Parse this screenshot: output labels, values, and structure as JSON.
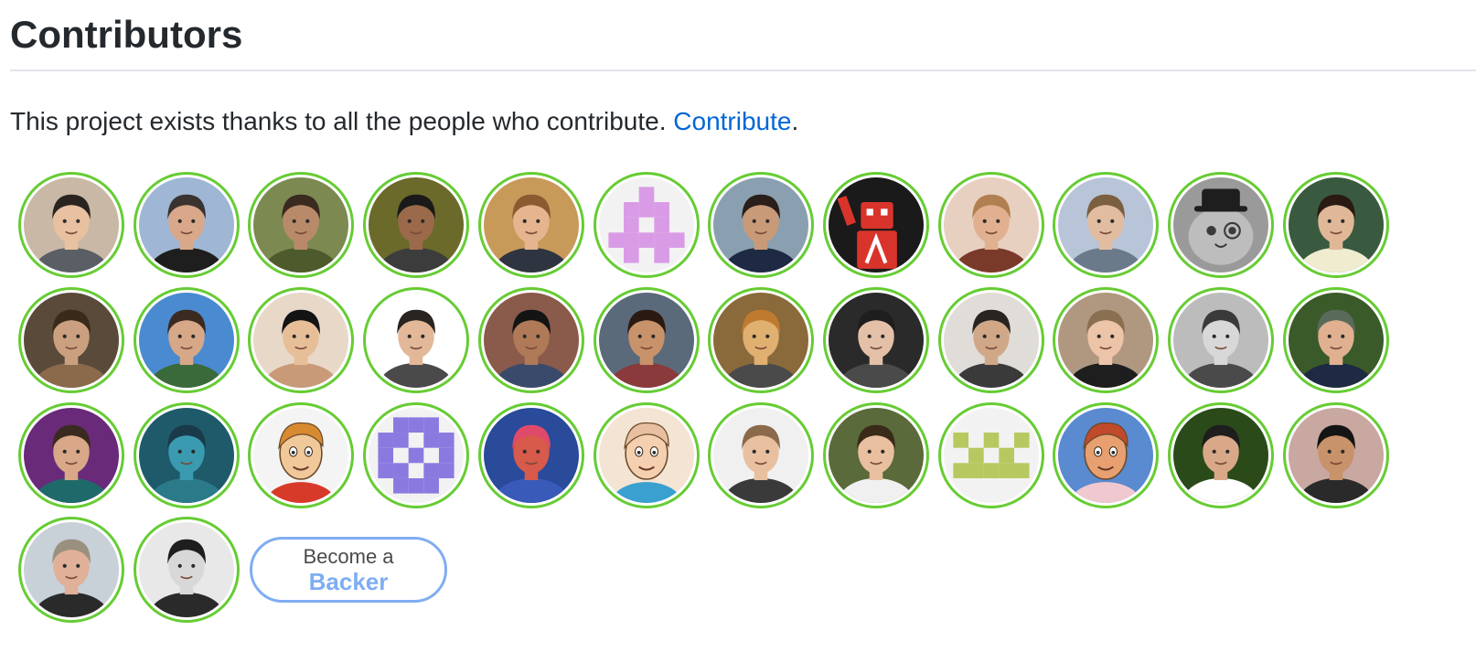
{
  "heading": "Contributors",
  "intro": {
    "text": "This project exists thanks to all the people who contribute.",
    "link_label": "Contribute",
    "suffix": "."
  },
  "colors": {
    "avatar_border": "#66cc33",
    "link": "#0366d6",
    "backer_accent": "#7fadf2"
  },
  "contributors": [
    {
      "kind": "photo",
      "bg": "#c9b8a6",
      "skin": "#e8c1a0",
      "hair": "#2a2420",
      "shirt": "#5a5f66"
    },
    {
      "kind": "photo",
      "bg": "#9fb6d4",
      "skin": "#d9a88a",
      "hair": "#3a3330",
      "shirt": "#1e1e1e"
    },
    {
      "kind": "photo",
      "bg": "#7c8a52",
      "skin": "#b98a6a",
      "hair": "#3b2a20",
      "shirt": "#4d5a2c"
    },
    {
      "kind": "photo",
      "bg": "#6b6a2a",
      "skin": "#9a6a4a",
      "hair": "#1a1a1a",
      "shirt": "#3c3c3c"
    },
    {
      "kind": "photo",
      "bg": "#c89a5a",
      "skin": "#e4b58e",
      "hair": "#8a5a30",
      "shirt": "#2e3440"
    },
    {
      "kind": "pixel",
      "bg": "#f2f2f2",
      "fg": "#d99be6",
      "pattern": "a"
    },
    {
      "kind": "photo",
      "bg": "#8aa0b0",
      "skin": "#c99a78",
      "hair": "#2a1f1a",
      "shirt": "#1e2a44"
    },
    {
      "kind": "robot",
      "bg": "#1a1a1a",
      "fg": "#d9342b"
    },
    {
      "kind": "photo",
      "bg": "#e8d0c0",
      "skin": "#e0b090",
      "hair": "#b08050",
      "shirt": "#7a3a2a"
    },
    {
      "kind": "photo",
      "bg": "#b8c4d8",
      "skin": "#e2bca0",
      "hair": "#7a6040",
      "shirt": "#6a7a8a"
    },
    {
      "kind": "cat",
      "bg": "#9a9a9a",
      "fg": "#5a5a5a"
    },
    {
      "kind": "photo",
      "bg": "#3a5a40",
      "skin": "#e0b898",
      "hair": "#2a1a12",
      "shirt": "#f0ecd0"
    },
    {
      "kind": "photo",
      "bg": "#5a4a3a",
      "skin": "#caa080",
      "hair": "#3a2a1a",
      "shirt": "#8a6a4a"
    },
    {
      "kind": "photo",
      "bg": "#4a8ad0",
      "skin": "#d6a888",
      "hair": "#3a2a20",
      "shirt": "#3a6a3a"
    },
    {
      "kind": "photo",
      "bg": "#e8d8c8",
      "skin": "#e6be98",
      "hair": "#141414",
      "shirt": "#c89a78"
    },
    {
      "kind": "photo",
      "bg": "#ffffff",
      "skin": "#e2b898",
      "hair": "#2a2420",
      "shirt": "#4a4a4a"
    },
    {
      "kind": "photo",
      "bg": "#8a5a4a",
      "skin": "#b07a58",
      "hair": "#141414",
      "shirt": "#3a4a6a"
    },
    {
      "kind": "photo",
      "bg": "#5a6a7a",
      "skin": "#c8926a",
      "hair": "#2a1a12",
      "shirt": "#8a3a3a"
    },
    {
      "kind": "photo",
      "bg": "#8a6a3a",
      "skin": "#e0b070",
      "hair": "#c07a30",
      "shirt": "#4a4a4a"
    },
    {
      "kind": "photo",
      "bg": "#2a2a2a",
      "skin": "#e4c0a8",
      "hair": "#1e1e1e",
      "shirt": "#4a4a4a"
    },
    {
      "kind": "photo",
      "bg": "#e0dcd8",
      "skin": "#d0a888",
      "hair": "#2a2420",
      "shirt": "#3a3a3a"
    },
    {
      "kind": "photo",
      "bg": "#b09880",
      "skin": "#ecc4a8",
      "hair": "#8a7050",
      "shirt": "#1e1e1e"
    },
    {
      "kind": "photo",
      "bg": "#bcbcbc",
      "skin": "#d8d8d8",
      "hair": "#3a3a3a",
      "shirt": "#4a4a4a"
    },
    {
      "kind": "photo",
      "bg": "#3a5a2a",
      "skin": "#e0b090",
      "hair": "#5a6a5a",
      "shirt": "#1e2a44"
    },
    {
      "kind": "photo",
      "bg": "#6a2a7a",
      "skin": "#d8a888",
      "hair": "#3a2a20",
      "shirt": "#1e6a6a"
    },
    {
      "kind": "photo",
      "bg": "#1e5a6a",
      "skin": "#3a9ab0",
      "hair": "#1a3a4a",
      "shirt": "#2a7a8a"
    },
    {
      "kind": "cartoon",
      "bg": "#f4f4f4",
      "skin": "#f0c89a",
      "hair": "#d88a30",
      "shirt": "#d83a2a"
    },
    {
      "kind": "pixel",
      "bg": "#f2f2f2",
      "fg": "#8a7ae0",
      "pattern": "o"
    },
    {
      "kind": "photo",
      "bg": "#2a4a9a",
      "skin": "#d85a4a",
      "hair": "#e04a6a",
      "shirt": "#3a5aba"
    },
    {
      "kind": "cartoon",
      "bg": "#f4e4d4",
      "skin": "#f4d0b0",
      "hair": "#e8c0a0",
      "shirt": "#3aa0d0"
    },
    {
      "kind": "photo",
      "bg": "#f0f0f0",
      "skin": "#e8c0a0",
      "hair": "#8a6a4a",
      "shirt": "#3a3a3a"
    },
    {
      "kind": "photo",
      "bg": "#5a6a3a",
      "skin": "#e8c0a0",
      "hair": "#3a2a1a",
      "shirt": "#f0f0f0"
    },
    {
      "kind": "pixel",
      "bg": "#f2f2f2",
      "fg": "#b8c860",
      "pattern": "x"
    },
    {
      "kind": "cartoon",
      "bg": "#5a8ad0",
      "skin": "#e8a070",
      "hair": "#c04a2a",
      "shirt": "#f0c8d0"
    },
    {
      "kind": "photo",
      "bg": "#2a4a1a",
      "skin": "#d8a888",
      "hair": "#1e1e1e",
      "shirt": "#ffffff"
    },
    {
      "kind": "photo",
      "bg": "#c8a8a0",
      "skin": "#c8926a",
      "hair": "#141414",
      "shirt": "#2a2a2a"
    },
    {
      "kind": "photo",
      "bg": "#c8d0d8",
      "skin": "#e0b098",
      "hair": "#9a9080",
      "shirt": "#2a2a2a"
    },
    {
      "kind": "photo",
      "bg": "#e8e8e8",
      "skin": "#d8d8d8",
      "hair": "#1e1e1e",
      "shirt": "#2a2a2a"
    }
  ],
  "backer": {
    "line1": "Become a",
    "line2": "Backer"
  }
}
